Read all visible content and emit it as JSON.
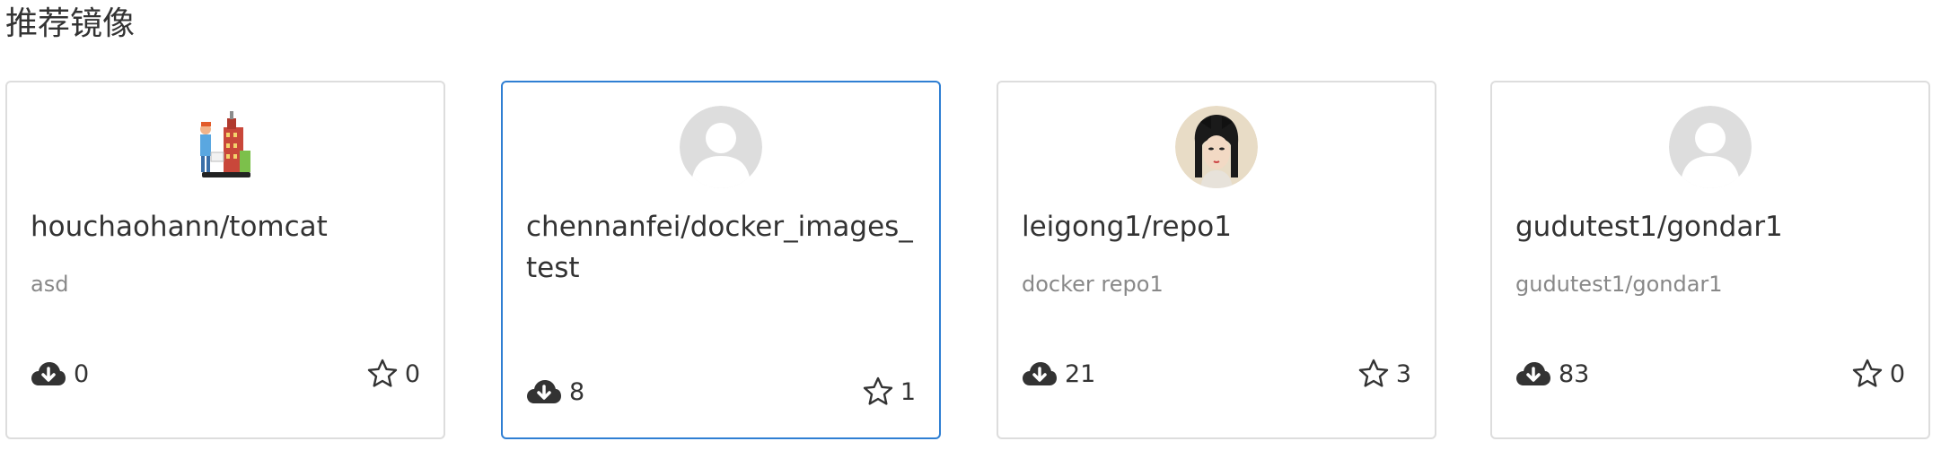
{
  "section": {
    "title": "推荐镜像"
  },
  "cards": [
    {
      "name": "houchaohann/tomcat",
      "description": "asd",
      "downloads": "0",
      "stars": "0",
      "avatar_icon": "tomcat-illustration-icon"
    },
    {
      "name": "chennanfei/docker_images_test",
      "description": "",
      "downloads": "8",
      "stars": "1",
      "avatar_icon": "default-user-avatar-icon"
    },
    {
      "name": "leigong1/repo1",
      "description": "docker repo1",
      "downloads": "21",
      "stars": "3",
      "avatar_icon": "user-portrait-icon"
    },
    {
      "name": "gudutest1/gondar1",
      "description": "gudutest1/gondar1",
      "downloads": "83",
      "stars": "0",
      "avatar_icon": "default-user-avatar-icon"
    }
  ],
  "icons": {
    "download": "cloud-download-icon",
    "star": "star-outline-icon"
  },
  "colors": {
    "active_border": "#2f7fd3",
    "card_border": "#dddddd",
    "description_text": "#888888",
    "default_avatar_bg": "#dddddd"
  }
}
